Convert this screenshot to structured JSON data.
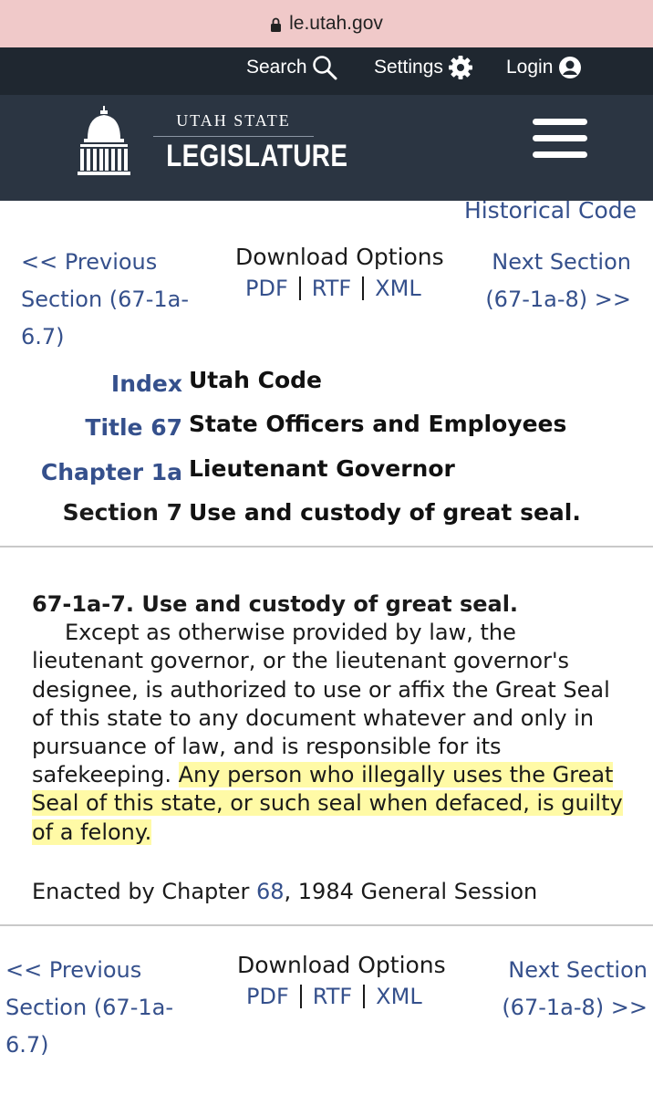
{
  "browser": {
    "url": "le.utah.gov"
  },
  "topbar": {
    "search_label": "Search",
    "settings_label": "Settings",
    "login_label": "Login"
  },
  "header": {
    "logo_top": "UTAH STATE",
    "logo_main": "LEGISLATURE"
  },
  "historical_link": "Historical Code",
  "nav": {
    "prev_line1": "<< Previous",
    "prev_line2": "Section (67-1a-",
    "prev_line3": "6.7)",
    "download_title": "Download Options",
    "pdf": "PDF",
    "rtf": "RTF",
    "xml": "XML",
    "next_line1": "Next Section",
    "next_line2": "(67-1a-8) >>"
  },
  "breadcrumbs": [
    {
      "key": "Index",
      "value": "Utah Code"
    },
    {
      "key": "Title 67",
      "value": "State Officers and Employees"
    },
    {
      "key": "Chapter 1a",
      "value": "Lieutenant Governor"
    },
    {
      "key": "Section 7",
      "value": "Use and custody of great seal."
    }
  ],
  "section": {
    "heading": "67-1a-7.  Use and custody of great seal.",
    "text_main": "Except as otherwise provided by law, the lieutenant governor, or the lieutenant governor's designee, is authorized to use or affix the Great Seal of this state to any document whatever and only in pursuance of law, and is responsible for its safekeeping. ",
    "text_highlight": "Any person who illegally uses the Great Seal of this state, or such seal when defaced, is guilty of a felony.",
    "enacted_prefix": "Enacted by Chapter ",
    "enacted_chapter": "68",
    "enacted_suffix": ", 1984 General Session"
  },
  "colors": {
    "link": "#35508c",
    "header_bg": "#2b3542",
    "topbar_bg": "#1f2730",
    "urlbar_bg": "#f0c9c9",
    "highlight": "#fff65c"
  }
}
